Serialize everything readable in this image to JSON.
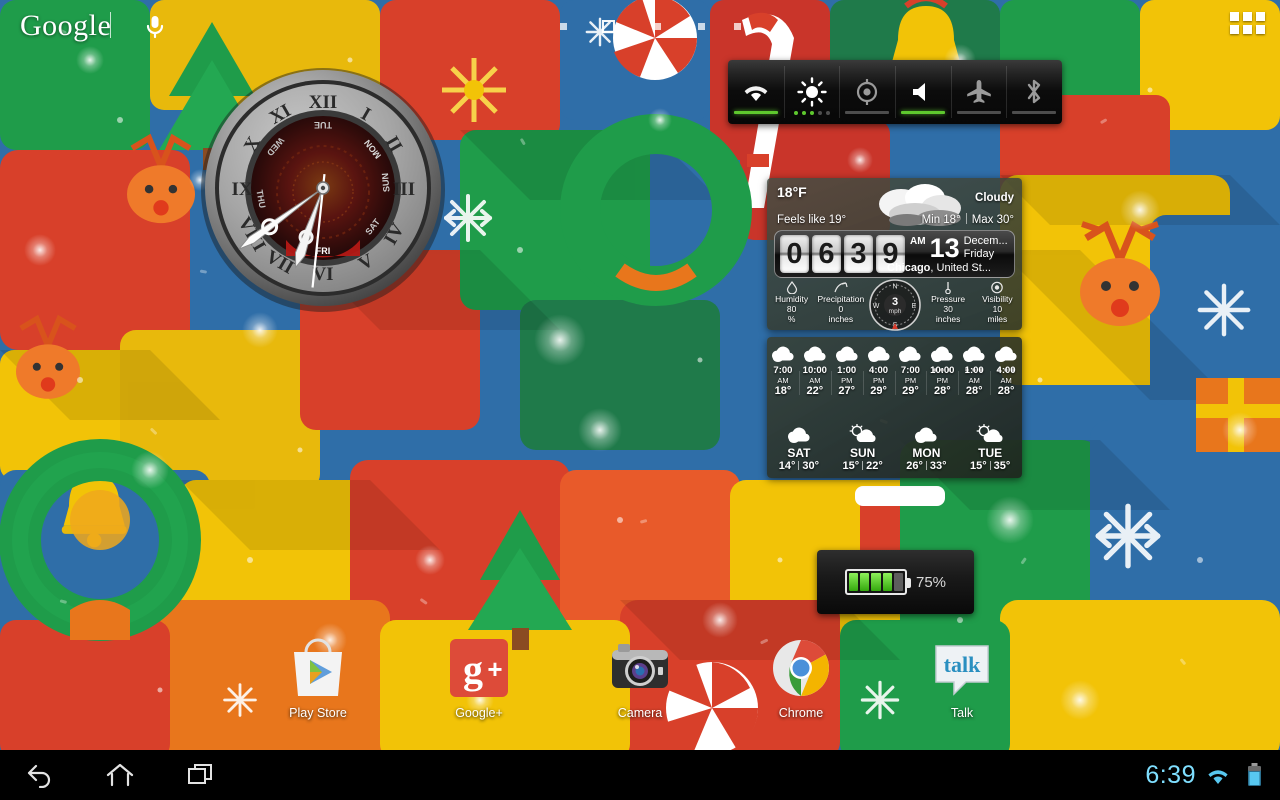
{
  "topbar": {
    "logo": "Google",
    "mic_icon": "microphone-icon",
    "apps_grid_icon": "apps-grid-icon",
    "page_count": 5,
    "current_page": 2
  },
  "toggles": {
    "items": [
      {
        "name": "wifi",
        "icon": "wifi-icon",
        "state": "on",
        "indicator": "bar"
      },
      {
        "name": "brightness",
        "icon": "brightness-icon",
        "state": "level",
        "indicator": "dots",
        "level": 3,
        "levels": 5
      },
      {
        "name": "gps",
        "icon": "location-icon",
        "state": "off",
        "indicator": "bar"
      },
      {
        "name": "volume",
        "icon": "volume-icon",
        "state": "on",
        "indicator": "bar"
      },
      {
        "name": "airplane",
        "icon": "airplane-icon",
        "state": "off",
        "indicator": "bar"
      },
      {
        "name": "bluetooth",
        "icon": "bluetooth-icon",
        "state": "off",
        "indicator": "bar"
      }
    ]
  },
  "weather": {
    "temp": "18",
    "unit": "°F",
    "feels_like": "Feels like  19°",
    "condition": "Cloudy",
    "min_label": "Min 18°",
    "max_label": "Max 30°",
    "condition_icon": "cloudy-icon",
    "clock": {
      "d1": "0",
      "d2": "6",
      "d3": "3",
      "d4": "9",
      "ampm": "AM"
    },
    "date_day": "13",
    "date_month": "Decem...",
    "date_weekday": "Friday",
    "location_city": "Chicago",
    "location_rest": ", United St...",
    "wind": {
      "speed": "3",
      "unit": "mph",
      "n": "N",
      "s": "S",
      "e": "E",
      "w": "W"
    },
    "stats": [
      {
        "icon": "humidity-icon",
        "label": "Humidity",
        "value": "80",
        "unit": "%"
      },
      {
        "icon": "precipitation-icon",
        "label": "Precipitation",
        "value": "0",
        "unit": "inches"
      },
      {
        "icon": "pressure-icon",
        "label": "Pressure",
        "value": "30",
        "unit": "inches"
      },
      {
        "icon": "visibility-icon",
        "label": "Visibility",
        "value": "10",
        "unit": "miles"
      }
    ]
  },
  "forecast": {
    "hourly": [
      {
        "time": "7:00",
        "ampm": "AM",
        "temp": "18°",
        "icon": "cloudy-icon",
        "snow": false
      },
      {
        "time": "10:00",
        "ampm": "AM",
        "temp": "22°",
        "icon": "cloudy-icon",
        "snow": false
      },
      {
        "time": "1:00",
        "ampm": "PM",
        "temp": "27°",
        "icon": "cloudy-icon",
        "snow": false
      },
      {
        "time": "4:00",
        "ampm": "PM",
        "temp": "29°",
        "icon": "cloudy-icon",
        "snow": false
      },
      {
        "time": "7:00",
        "ampm": "PM",
        "temp": "29°",
        "icon": "cloudy-icon",
        "snow": false
      },
      {
        "time": "10:00",
        "ampm": "PM",
        "temp": "28°",
        "icon": "snow-cloud-icon",
        "snow": true
      },
      {
        "time": "1:00",
        "ampm": "AM",
        "temp": "28°",
        "icon": "snow-cloud-icon",
        "snow": true
      },
      {
        "time": "4:00",
        "ampm": "AM",
        "temp": "28°",
        "icon": "snow-cloud-icon",
        "snow": true
      }
    ],
    "daily": [
      {
        "day": "SAT",
        "low": "14°",
        "high": "30°",
        "icon": "snow-cloud-icon"
      },
      {
        "day": "SUN",
        "low": "15°",
        "high": "22°",
        "icon": "partly-sunny-icon"
      },
      {
        "day": "MON",
        "low": "26°",
        "high": "33°",
        "icon": "cloudy-icon"
      },
      {
        "day": "TUE",
        "low": "15°",
        "high": "35°",
        "icon": "partly-sunny-icon"
      }
    ]
  },
  "battery": {
    "percent_label": "75%",
    "segments_filled": 4,
    "segments_total": 5,
    "icon": "battery-icon"
  },
  "clock_widget": {
    "icon": "analog-clock-widget",
    "numerals": [
      "XII",
      "I",
      "II",
      "III",
      "IV",
      "V",
      "VI",
      "VII",
      "VIII",
      "IX",
      "X",
      "XI"
    ],
    "day_ring": [
      "MON",
      "TUE",
      "WED",
      "THU",
      "FRI",
      "SAT",
      "SUN"
    ],
    "active_day": "FRI"
  },
  "dock": {
    "apps": [
      {
        "name": "play-store",
        "label": "Play Store",
        "icon": "play-store-icon"
      },
      {
        "name": "google-plus",
        "label": "Google+",
        "icon": "google-plus-icon"
      },
      {
        "name": "camera",
        "label": "Camera",
        "icon": "camera-icon"
      },
      {
        "name": "chrome",
        "label": "Chrome",
        "icon": "chrome-icon"
      },
      {
        "name": "talk",
        "label": "Talk",
        "icon": "talk-icon",
        "text": "talk"
      }
    ]
  },
  "system_bar": {
    "back_icon": "back-icon",
    "home_icon": "home-icon",
    "recents_icon": "recents-icon",
    "time": "6:39",
    "wifi_icon": "wifi-icon",
    "battery_icon": "battery-icon"
  },
  "colors": {
    "accent_green": "#5ec82e",
    "system_blue": "#7fdfff",
    "wallpaper_blue": "#2f6ea8",
    "wallpaper_yellow": "#f2c307",
    "wallpaper_red": "#d8402a",
    "wallpaper_green": "#1f9c4a"
  }
}
